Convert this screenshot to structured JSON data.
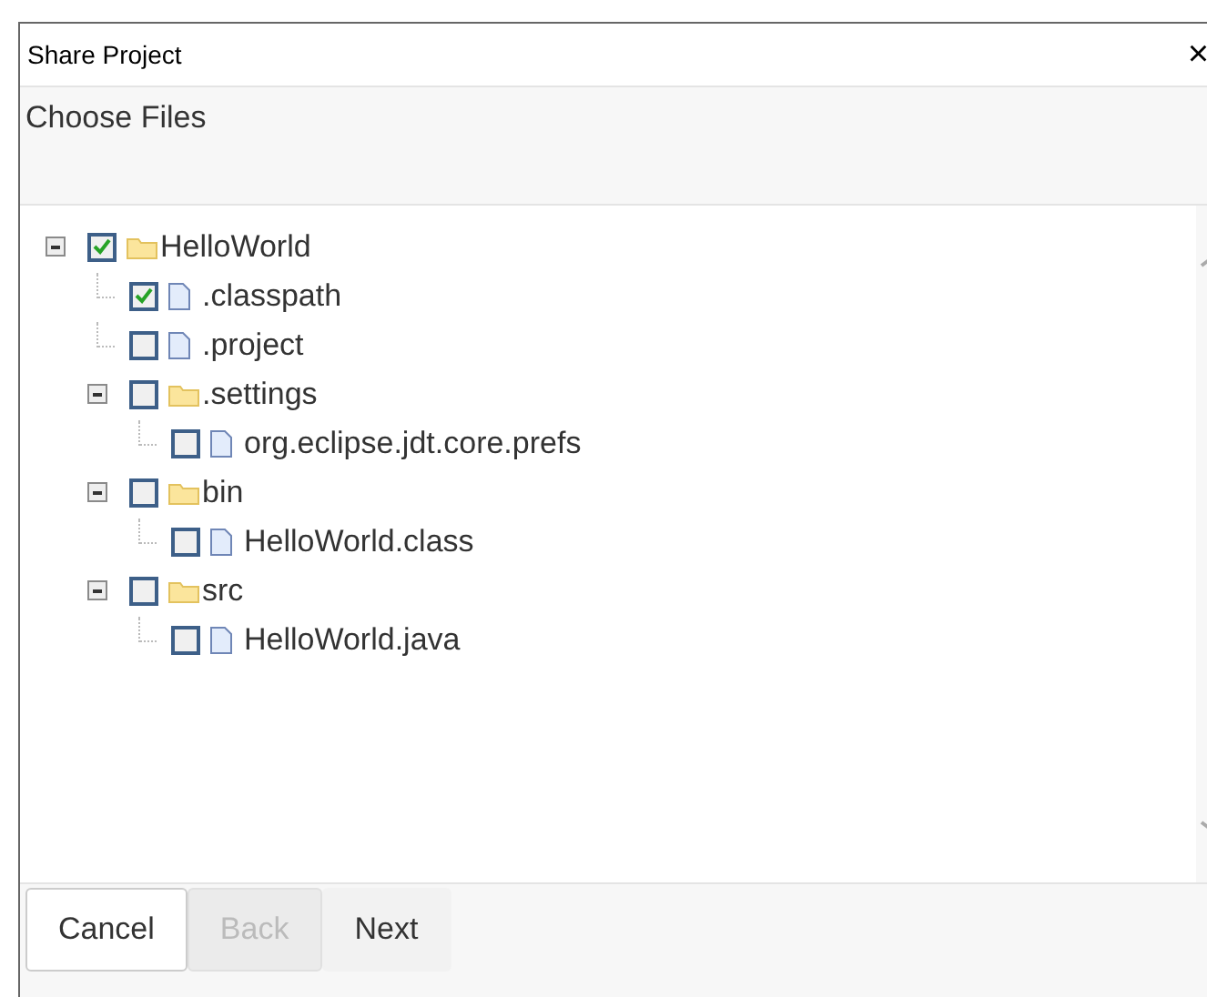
{
  "window": {
    "title": "Share Project",
    "close": "×"
  },
  "header": {
    "title": "Choose Files"
  },
  "tree": [
    {
      "label": "HelloWorld",
      "kind": "folder",
      "checked": true,
      "expanded": true,
      "children": [
        {
          "label": ".classpath",
          "kind": "file",
          "checked": true
        },
        {
          "label": ".project",
          "kind": "file",
          "checked": false
        },
        {
          "label": ".settings",
          "kind": "folder",
          "checked": false,
          "expanded": true,
          "children": [
            {
              "label": "org.eclipse.jdt.core.prefs",
              "kind": "file",
              "checked": false
            }
          ]
        },
        {
          "label": "bin",
          "kind": "folder",
          "checked": false,
          "expanded": true,
          "children": [
            {
              "label": "HelloWorld.class",
              "kind": "file",
              "checked": false
            }
          ]
        },
        {
          "label": "src",
          "kind": "folder",
          "checked": false,
          "expanded": true,
          "children": [
            {
              "label": "HelloWorld.java",
              "kind": "file",
              "checked": false
            }
          ]
        }
      ]
    }
  ],
  "buttons": [
    {
      "label": "Cancel",
      "kind": "outlined",
      "disabled": false
    },
    {
      "label": "Back",
      "kind": "filled",
      "disabled": true
    },
    {
      "label": "Next",
      "kind": "filled",
      "disabled": false
    }
  ]
}
